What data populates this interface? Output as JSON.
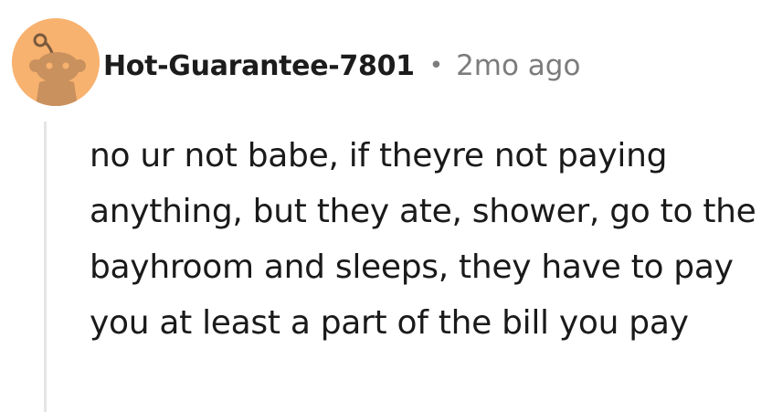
{
  "comment": {
    "author": {
      "avatar_icon": "snoo-avatar-icon",
      "avatar_color": "#f8b26f",
      "username": "Hot-Guarantee-7801"
    },
    "separator": "•",
    "timestamp": "2mo ago",
    "body": "no ur not babe, if theyre not paying anything, but they ate, shower, go to the bayhroom and sleeps, they have to pay you at least a part of the bill you pay"
  },
  "colors": {
    "username": "#1c1c1c",
    "meta": "#7c7c7c",
    "body_text": "#1a1a1b",
    "thread_line": "#e5e5e5"
  }
}
